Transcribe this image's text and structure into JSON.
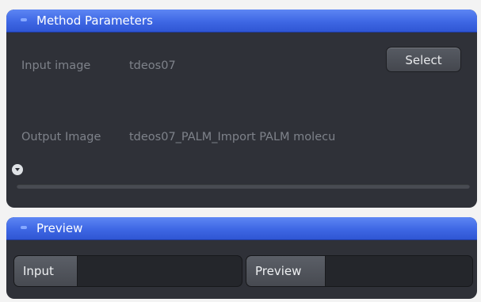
{
  "method_parameters": {
    "title": "Method Parameters",
    "input_image_label": "Input image",
    "input_image_value": "tdeos07",
    "select_button_label": "Select",
    "output_image_label": "Output Image",
    "output_image_value": "tdeos07_PALM_Import PALM molecu"
  },
  "preview": {
    "title": "Preview",
    "input_tab_label": "Input",
    "preview_tab_label": "Preview"
  },
  "icons": {
    "collapse": "collapse-icon",
    "expand": "chevron-down-icon"
  },
  "colors": {
    "header_blue": "#3e67e4",
    "panel_bg": "#2f3138",
    "text_muted": "#7e828a"
  }
}
